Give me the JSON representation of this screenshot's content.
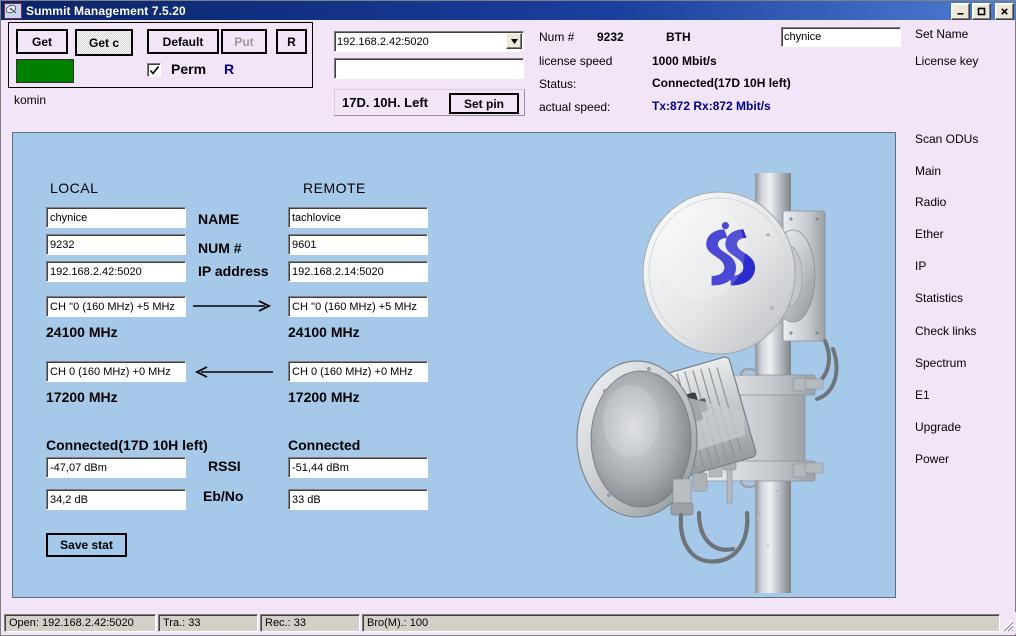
{
  "window": {
    "title": "Summit Management 7.5.20",
    "icon": "satellite-dish-icon",
    "minimize": "_",
    "maximize": "□",
    "close": "✕"
  },
  "toolbar": {
    "get_label": "Get",
    "getc_label": "Get c",
    "default_label": "Default",
    "put_label": "Put",
    "r_label": "R",
    "perm_label": "Perm",
    "perm_r_label": "R",
    "perm_checked": true,
    "indicator_color": "#008000",
    "site_label": "komin"
  },
  "connection": {
    "address_value": "192.168.2.42:5020",
    "pin_value": "",
    "pin_placeholder": "",
    "license_left": "17D.  10H. Left",
    "set_pin_label": "Set pin"
  },
  "status": {
    "num_label": "Num #",
    "num_value": "9232",
    "mode_value": "BTH",
    "license_speed_label": "license speed",
    "license_speed_value": "1000 Mbit/s",
    "status_label": "Status:",
    "status_value": "Connected(17D 10H left)",
    "actual_speed_label": "actual speed:",
    "actual_speed_value": "Tx:872 Rx:872 Mbit/s",
    "actual_speed_color": "#00008b",
    "name_value": "chynice"
  },
  "side_buttons": {
    "top": [
      {
        "label": "Set Name",
        "name": "set-name-button"
      },
      {
        "label": "License key",
        "name": "license-key-button"
      }
    ],
    "nav": [
      {
        "label": "Scan ODUs",
        "name": "scan-odus-button"
      },
      {
        "label": "Main",
        "name": "main-button"
      },
      {
        "label": "Radio",
        "name": "radio-button"
      },
      {
        "label": "Ether",
        "name": "ether-button"
      },
      {
        "label": "IP",
        "name": "ip-button"
      },
      {
        "label": "Statistics",
        "name": "statistics-button"
      },
      {
        "label": "Check links",
        "name": "check-links-button"
      },
      {
        "label": "Spectrum",
        "name": "spectrum-button"
      },
      {
        "label": "E1",
        "name": "e1-button"
      },
      {
        "label": "Upgrade",
        "name": "upgrade-button"
      },
      {
        "label": "Power",
        "name": "power-button"
      }
    ]
  },
  "link_panel": {
    "panel_color": "#a6c9ea",
    "local_heading": "LOCAL",
    "remote_heading": "REMOTE",
    "row_labels": {
      "name": "NAME",
      "num": "NUM #",
      "ip": "IP address",
      "rssi": "RSSI",
      "ebno": "Eb/No"
    },
    "local": {
      "name": "chynice",
      "num": "9232",
      "ip": "192.168.2.42:5020",
      "channel_tx": "CH ''0 (160 MHz) +5 MHz",
      "freq_tx": "24100 MHz",
      "channel_rx": "CH  0 (160 MHz) +0 MHz",
      "freq_rx": "17200 MHz",
      "state": "Connected(17D 10H left)",
      "rssi": "-47,07 dBm",
      "ebno": "34,2 dB"
    },
    "remote": {
      "name": "tachlovice",
      "num": "9601",
      "ip": "192.168.2.14:5020",
      "channel_tx": "CH ''0 (160 MHz) +5 MHz",
      "freq_tx": "24100 MHz",
      "channel_rx": "CH  0 (160 MHz) +0 MHz",
      "freq_rx": "17200 MHz",
      "state": "Connected",
      "rssi": "-51,44 dBm",
      "ebno": "33 dB"
    },
    "arrow_tx": "arrow-right-icon",
    "arrow_rx": "arrow-left-icon",
    "save_stat_label": "Save stat",
    "illustration": "microwave-antenna-photo"
  },
  "statusbar": {
    "open": "Open: 192.168.2.42:5020",
    "tra": "Tra.: 33",
    "rec": "Rec.: 33",
    "bro": "Bro(M).: 100"
  }
}
